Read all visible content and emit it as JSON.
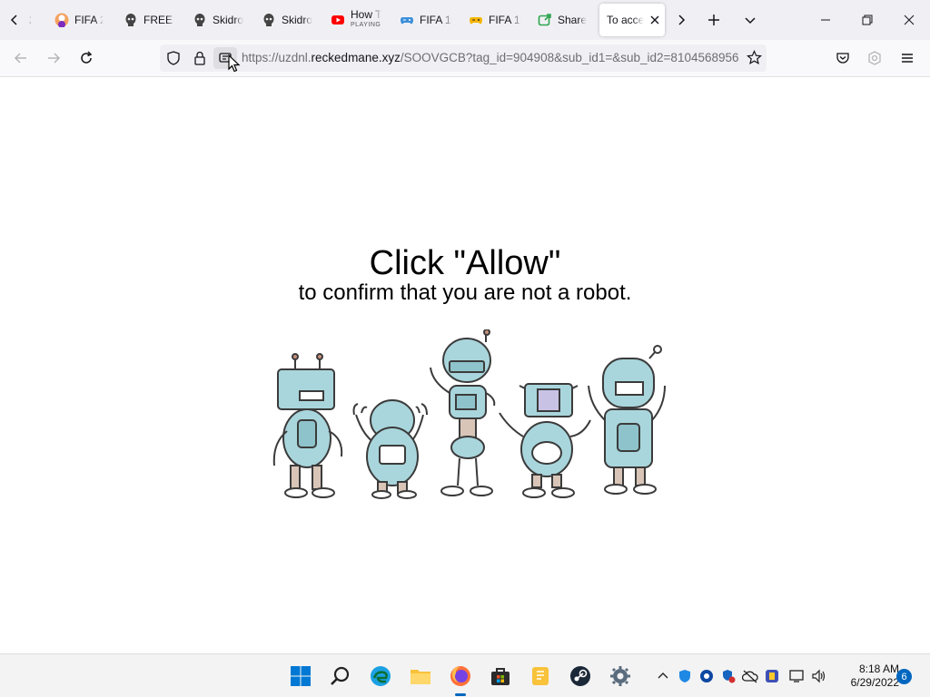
{
  "browser": {
    "tabs": [
      {
        "label": "2",
        "icon": "partial-tab-icon"
      },
      {
        "label": "FIFA 2",
        "icon": "fifa-avatar-icon"
      },
      {
        "label": "FREE T",
        "icon": "skull-icon"
      },
      {
        "label": "Skidro",
        "icon": "skull-icon"
      },
      {
        "label": "Skidro",
        "icon": "skull-icon"
      },
      {
        "label": "How T",
        "sub": "PLAYING",
        "icon": "youtube-icon"
      },
      {
        "label": "FIFA 1(",
        "icon": "gamepad-icon"
      },
      {
        "label": "FIFA 1(",
        "icon": "gamepad-yellow-icon"
      },
      {
        "label": "Share",
        "icon": "share-icon"
      },
      {
        "label": "To acce",
        "icon": "none",
        "active": true
      }
    ],
    "url_prefix": "https://uzdnl.",
    "url_domain": "reckedmane.xyz",
    "url_path": "/SOOVGCB?tag_id=904908&sub_id1=&sub_id2=8104568956"
  },
  "page": {
    "headline": "Click \"Allow\"",
    "subline": "to confirm that you are not a robot."
  },
  "taskbar": {
    "clock_time": "8:18 AM",
    "clock_date": "6/29/2022",
    "notification_count": "6",
    "accent": "#0067c0"
  }
}
